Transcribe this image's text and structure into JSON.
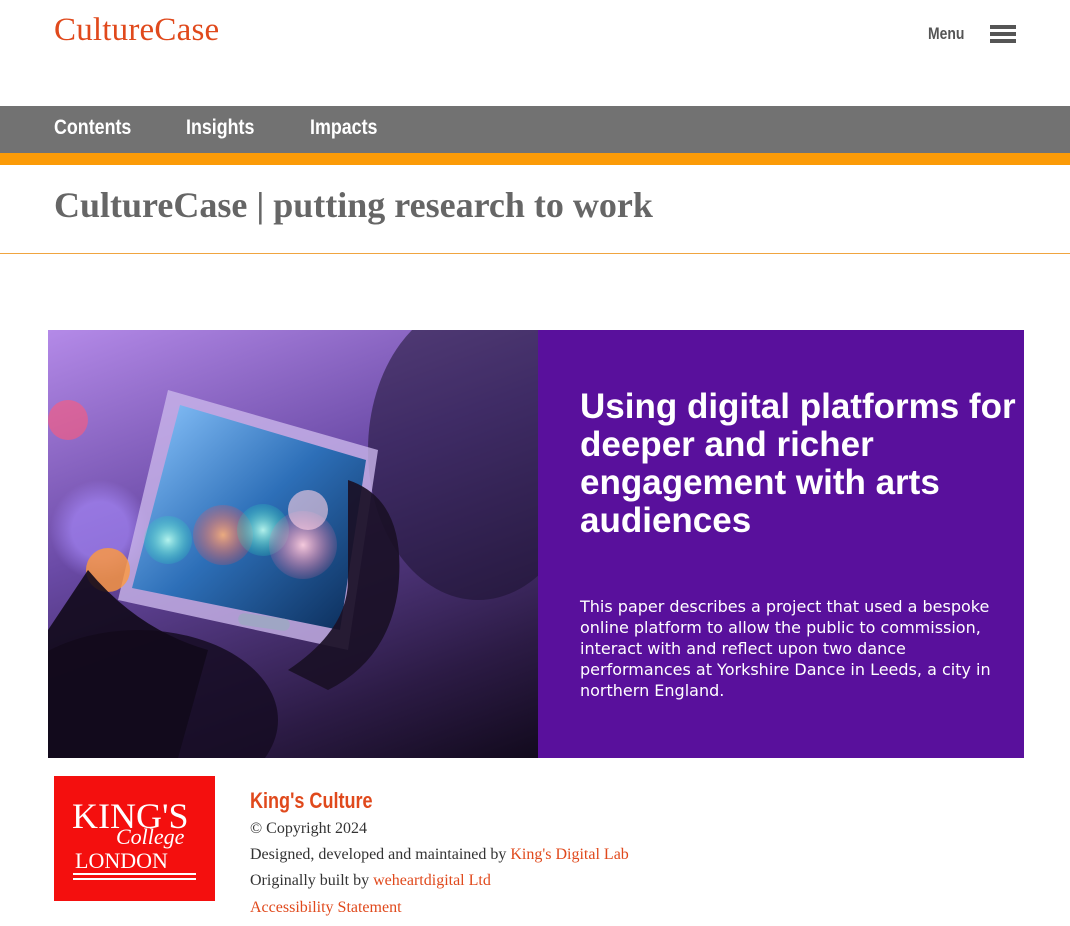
{
  "header": {
    "brand": "CultureCase",
    "menu_label": "Menu",
    "menu_icon": "hamburger-icon"
  },
  "nav": {
    "items": [
      {
        "label": "Contents"
      },
      {
        "label": "Insights"
      },
      {
        "label": "Impacts"
      }
    ]
  },
  "page": {
    "title": "CultureCase | putting research to work"
  },
  "hero": {
    "heading": "Using digital platforms for deeper and richer engagement with arts audiences",
    "summary": "This paper describes a project that used a bespoke online platform to allow the public to commission, interact with and reflect upon two dance performances at Yorkshire Dance in Leeds, a city in northern England.",
    "panel_color": "#59109c"
  },
  "footer": {
    "logo_text": {
      "king": "KING'S",
      "college": "College",
      "london": "LONDON"
    },
    "org_name": "King's Culture",
    "copyright": "© Copyright 2024",
    "designed_prefix": "Designed, developed and maintained by",
    "designed_link": "King's Digital Lab",
    "built_prefix": "Originally built by",
    "built_link": "weheartdigital Ltd",
    "accessibility_link": "Accessibility Statement"
  },
  "colors": {
    "brand": "#e0491c",
    "nav_bg": "#727272",
    "nav_stripe": "#fb9b07",
    "logo_bg": "#f40f0e"
  }
}
